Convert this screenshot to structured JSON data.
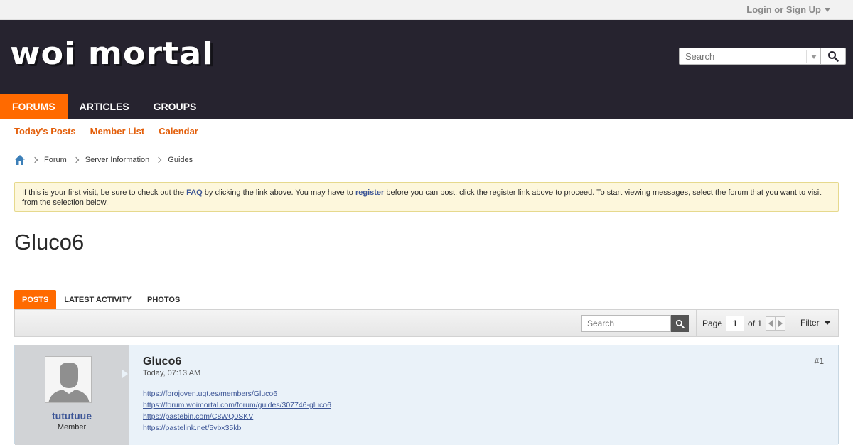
{
  "topbar": {
    "login_label": "Login or Sign Up"
  },
  "header": {
    "logo_text": "woi mortal",
    "search_placeholder": "Search",
    "nav": [
      {
        "label": "FORUMS",
        "active": true
      },
      {
        "label": "ARTICLES",
        "active": false
      },
      {
        "label": "GROUPS",
        "active": false
      }
    ]
  },
  "subnav": [
    "Today's Posts",
    "Member List",
    "Calendar"
  ],
  "breadcrumb": [
    "Forum",
    "Server Information",
    "Guides"
  ],
  "notice": {
    "part1": "If this is your first visit, be sure to check out the ",
    "faq": "FAQ",
    "part2": " by clicking the link above. You may have to ",
    "register": "register",
    "part3": " before you can post: click the register link above to proceed. To start viewing messages, select the forum that you want to visit from the selection below."
  },
  "page_title": "Gluco6",
  "tabs": [
    "POSTS",
    "LATEST ACTIVITY",
    "PHOTOS"
  ],
  "toolbar": {
    "search_placeholder": "Search",
    "page_label": "Page",
    "page_value": "1",
    "of_label": "of 1",
    "filter_label": "Filter"
  },
  "post": {
    "username": "tututuue",
    "role": "Member",
    "title": "Gluco6",
    "date": "Today, 07:13 AM",
    "number": "#1",
    "links": [
      "https://forojoven.ugt.es/members/Gluco6",
      "https://forum.woimortal.com/forum/guides/307746-gluco6",
      "https://pastebin.com/C8WQ0SKV",
      "https://pastelink.net/5vbx35kb"
    ]
  },
  "colors": {
    "accent": "#ff6a00",
    "header_bg": "#26232f",
    "link": "#3c5596",
    "subnav_link": "#e35f0b"
  }
}
